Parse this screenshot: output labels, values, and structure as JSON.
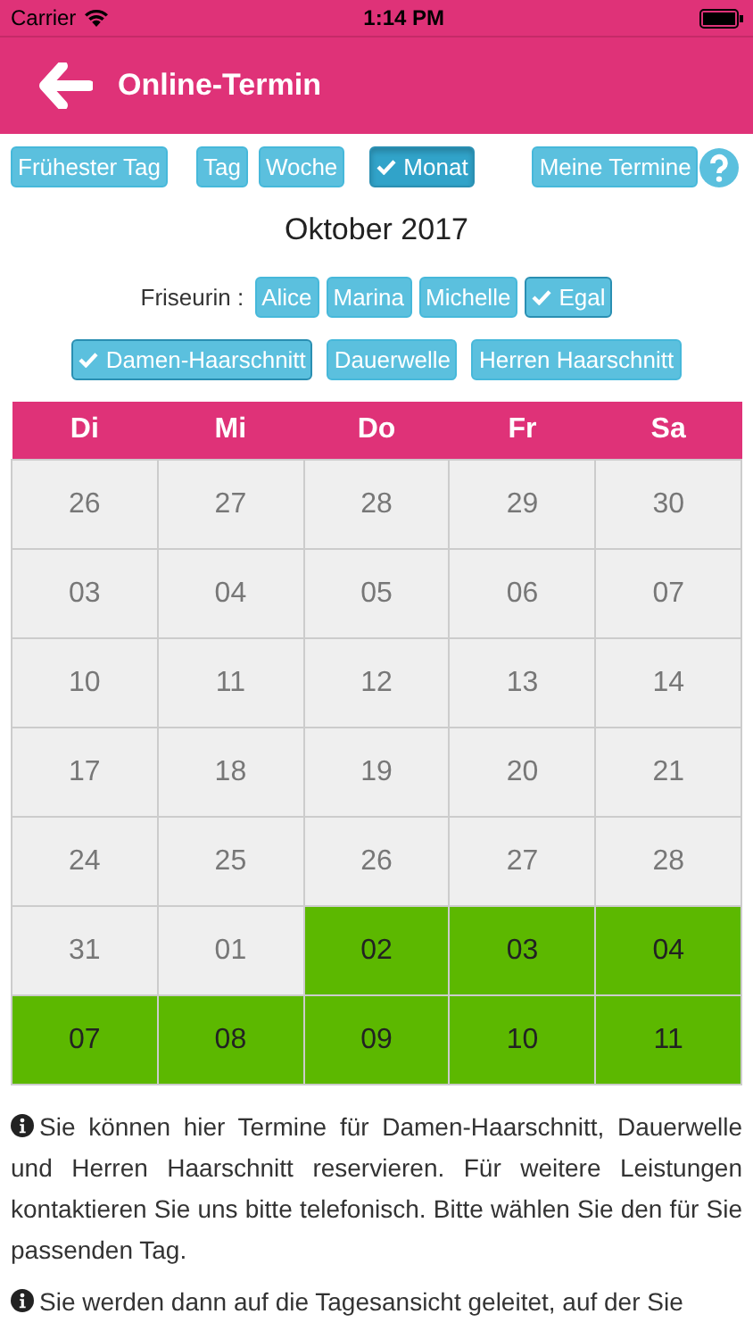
{
  "status_bar": {
    "carrier": "Carrier",
    "time": "1:14 PM"
  },
  "header": {
    "title": "Online-Termin"
  },
  "view_buttons": [
    {
      "label": "Frühester Tag",
      "selected": false
    },
    {
      "label": "Tag",
      "selected": false
    },
    {
      "label": "Woche",
      "selected": false
    },
    {
      "label": "Monat",
      "selected": true
    },
    {
      "label": "Meine Termine",
      "selected": false
    }
  ],
  "month_title": "Oktober 2017",
  "stylist": {
    "label": "Friseurin :",
    "options": [
      {
        "label": "Alice",
        "selected": false
      },
      {
        "label": "Marina",
        "selected": false
      },
      {
        "label": "Michelle",
        "selected": false
      },
      {
        "label": "Egal",
        "selected": true
      }
    ]
  },
  "services": [
    {
      "label": "Damen-Haarschnitt",
      "selected": true
    },
    {
      "label": "Dauerwelle",
      "selected": false
    },
    {
      "label": "Herren Haarschnitt",
      "selected": false
    }
  ],
  "calendar": {
    "weekdays": [
      "Di",
      "Mi",
      "Do",
      "Fr",
      "Sa"
    ],
    "weeks": [
      [
        {
          "day": "26",
          "available": false
        },
        {
          "day": "27",
          "available": false
        },
        {
          "day": "28",
          "available": false
        },
        {
          "day": "29",
          "available": false
        },
        {
          "day": "30",
          "available": false
        }
      ],
      [
        {
          "day": "03",
          "available": false
        },
        {
          "day": "04",
          "available": false
        },
        {
          "day": "05",
          "available": false
        },
        {
          "day": "06",
          "available": false
        },
        {
          "day": "07",
          "available": false
        }
      ],
      [
        {
          "day": "10",
          "available": false
        },
        {
          "day": "11",
          "available": false
        },
        {
          "day": "12",
          "available": false
        },
        {
          "day": "13",
          "available": false
        },
        {
          "day": "14",
          "available": false
        }
      ],
      [
        {
          "day": "17",
          "available": false
        },
        {
          "day": "18",
          "available": false
        },
        {
          "day": "19",
          "available": false
        },
        {
          "day": "20",
          "available": false
        },
        {
          "day": "21",
          "available": false
        }
      ],
      [
        {
          "day": "24",
          "available": false
        },
        {
          "day": "25",
          "available": false
        },
        {
          "day": "26",
          "available": false
        },
        {
          "day": "27",
          "available": false
        },
        {
          "day": "28",
          "available": false
        }
      ],
      [
        {
          "day": "31",
          "available": false
        },
        {
          "day": "01",
          "available": false
        },
        {
          "day": "02",
          "available": true
        },
        {
          "day": "03",
          "available": true
        },
        {
          "day": "04",
          "available": true
        }
      ],
      [
        {
          "day": "07",
          "available": true
        },
        {
          "day": "08",
          "available": true
        },
        {
          "day": "09",
          "available": true
        },
        {
          "day": "10",
          "available": true
        },
        {
          "day": "11",
          "available": true
        }
      ]
    ]
  },
  "info": [
    "Sie können hier Termine für Damen-Haarschnitt, Dauerwelle und Herren Haarschnitt reservieren. Für weitere Leistungen kontaktieren Sie uns bitte telefonisch. Bitte wählen Sie den für Sie passenden Tag.",
    "Sie werden dann auf die Tagesansicht geleitet, auf der Sie"
  ]
}
